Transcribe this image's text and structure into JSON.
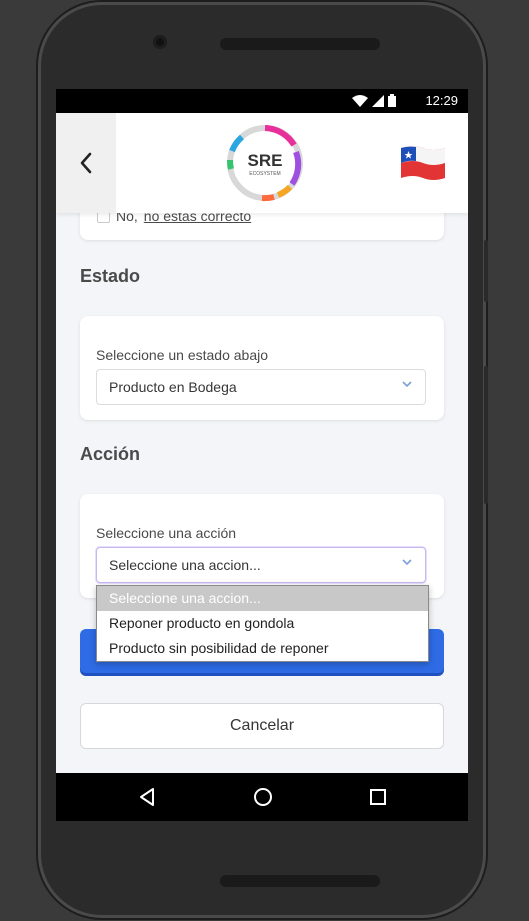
{
  "status_bar": {
    "time": "12:29"
  },
  "header": {
    "back_icon": "chevron-left-icon",
    "logo": {
      "main": "SRE",
      "sub": "ECOSYSTEM"
    },
    "flag_icon": "chile-flag-icon"
  },
  "confirm": {
    "prefix": "No, ",
    "link": "no estas correcto"
  },
  "estado": {
    "title": "Estado",
    "label": "Seleccione un estado abajo",
    "value": "Producto en Bodega"
  },
  "accion": {
    "title": "Acción",
    "label": "Seleccione una acción",
    "value": "Seleccione una accion...",
    "options": [
      "Seleccione una accion...",
      "Reponer producto en gondola",
      "Producto sin posibilidad de reponer"
    ]
  },
  "buttons": {
    "cancel": "Cancelar"
  },
  "colors": {
    "primary": "#2e6be5",
    "text": "#4a4a4a",
    "background": "#f4f5f8"
  }
}
